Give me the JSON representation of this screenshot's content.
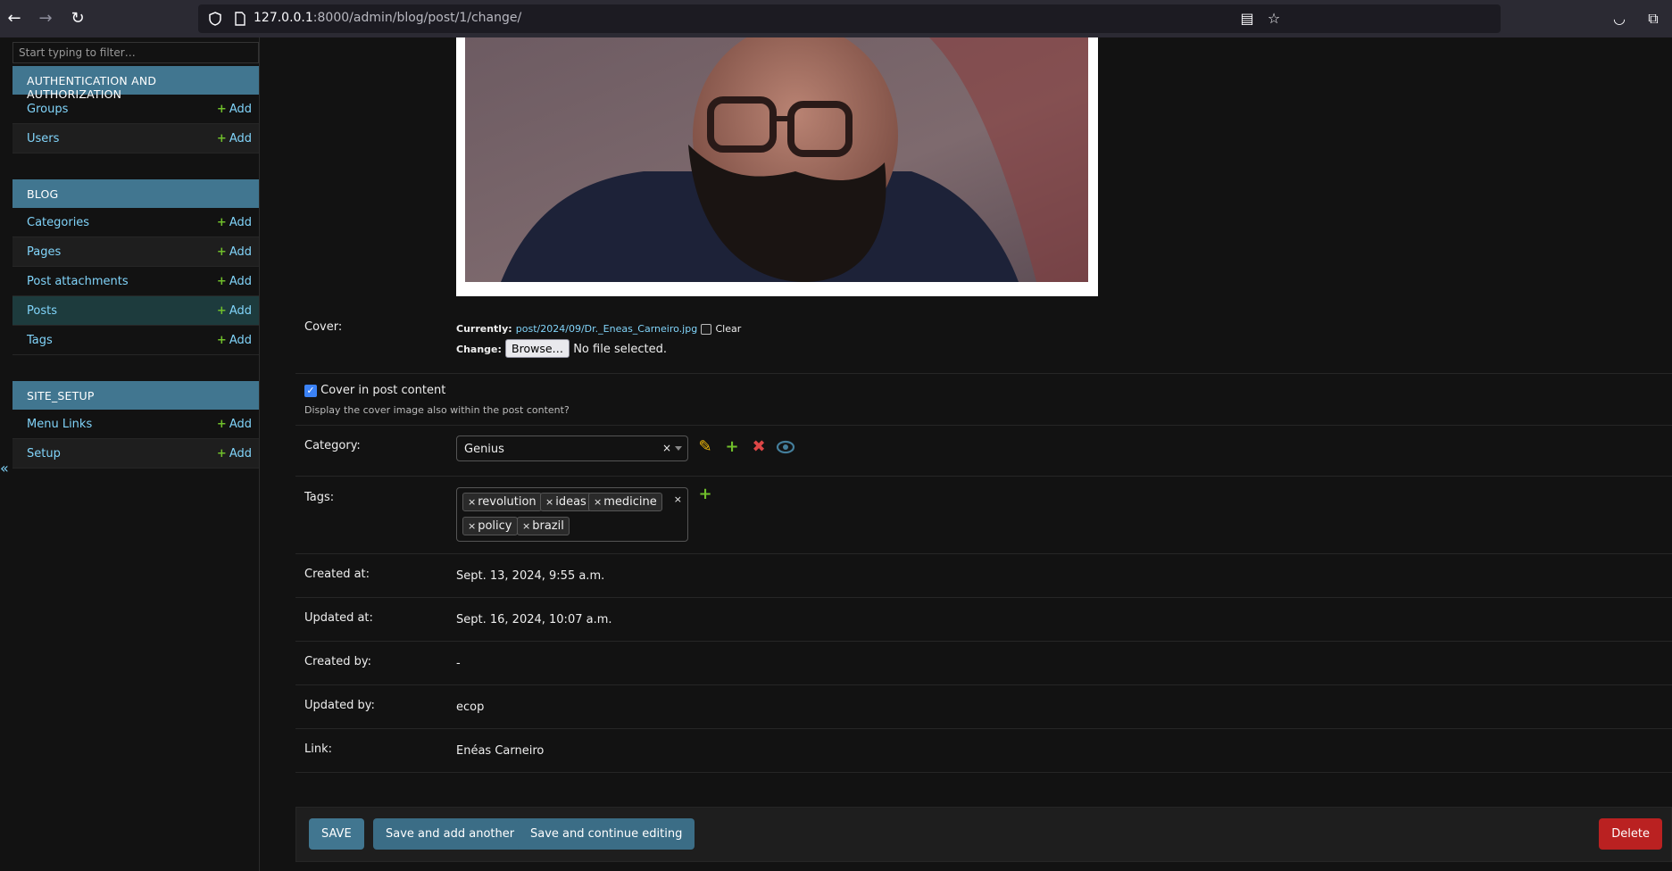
{
  "browser": {
    "url_host": "127.0.0.1",
    "url_rest": ":8000/admin/blog/post/1/change/"
  },
  "sidebar": {
    "filter_placeholder": "Start typing to filter…",
    "modules": [
      {
        "title": "AUTHENTICATION AND AUTHORIZATION",
        "items": [
          {
            "label": "Groups",
            "add": "Add"
          },
          {
            "label": "Users",
            "add": "Add"
          }
        ]
      },
      {
        "title": "BLOG",
        "items": [
          {
            "label": "Categories",
            "add": "Add"
          },
          {
            "label": "Pages",
            "add": "Add"
          },
          {
            "label": "Post attachments",
            "add": "Add"
          },
          {
            "label": "Posts",
            "add": "Add"
          },
          {
            "label": "Tags",
            "add": "Add"
          }
        ]
      },
      {
        "title": "SITE_SETUP",
        "items": [
          {
            "label": "Menu Links",
            "add": "Add"
          },
          {
            "label": "Setup",
            "add": "Add"
          }
        ]
      }
    ],
    "collapse_symbol": "«"
  },
  "form": {
    "cover": {
      "label": "Cover:",
      "currently_label": "Currently:",
      "current_file": "post/2024/09/Dr._Eneas_Carneiro.jpg",
      "clear_label": "Clear",
      "change_label": "Change:",
      "browse_label": "Browse…",
      "no_file": "No file selected."
    },
    "cover_in_content": {
      "label": "Cover in post content",
      "help": "Display the cover image also within the post content?",
      "checked": true
    },
    "category": {
      "label": "Category:",
      "value": "Genius"
    },
    "tags": {
      "label": "Tags:",
      "values": [
        "revolution",
        "ideas",
        "medicine",
        "policy",
        "brazil"
      ]
    },
    "created_at": {
      "label": "Created at:",
      "value": "Sept. 13, 2024, 9:55 a.m."
    },
    "updated_at": {
      "label": "Updated at:",
      "value": "Sept. 16, 2024, 10:07 a.m."
    },
    "created_by": {
      "label": "Created by:",
      "value": "-"
    },
    "updated_by": {
      "label": "Updated by:",
      "value": "ecop"
    },
    "link": {
      "label": "Link:",
      "value": "Enéas Carneiro"
    }
  },
  "actions": {
    "save": "SAVE",
    "save_add": "Save and add another",
    "save_continue": "Save and continue editing",
    "delete": "Delete"
  },
  "colors": {
    "header": "#417690",
    "link": "#81d4fa",
    "add_plus": "#70bf2b",
    "delete": "#ba2121"
  }
}
